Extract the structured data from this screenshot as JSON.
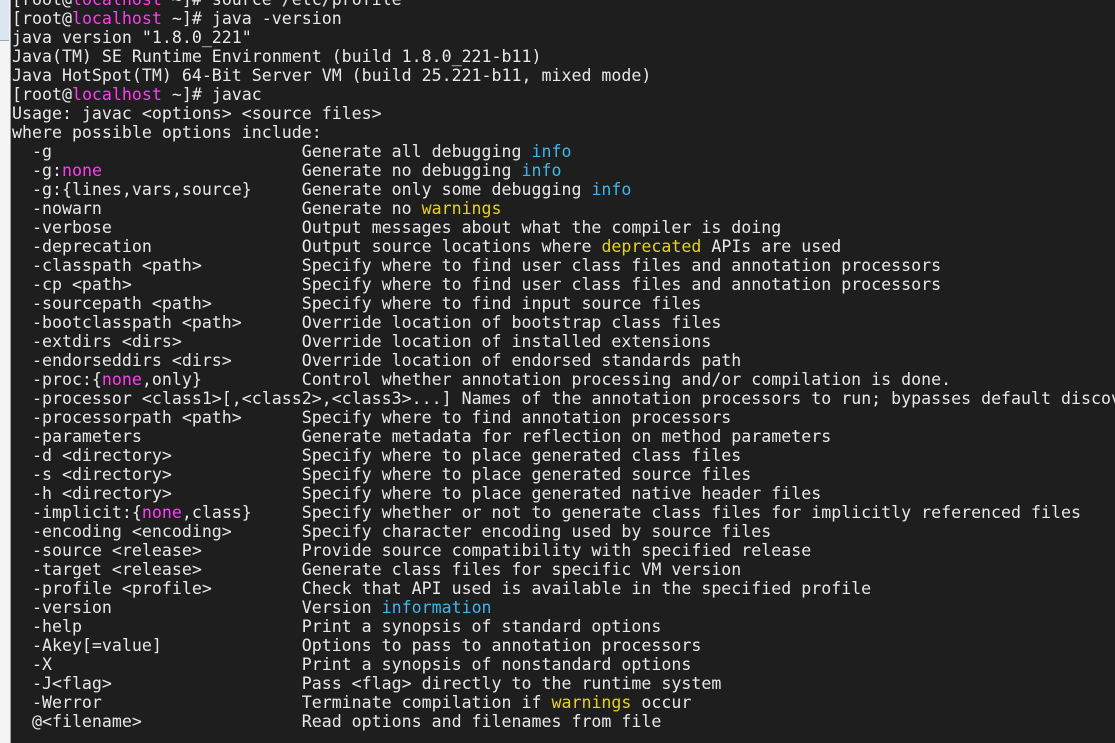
{
  "colors": {
    "background": "#1e1e1e",
    "text": "#e8e8e8",
    "magenta": "#ff3cf0",
    "cyan": "#3fb6e8",
    "yellow": "#e6d21e"
  },
  "header_lines": [
    [
      {
        "t": "[root@"
      },
      {
        "t": "localhost",
        "c": "magenta"
      },
      {
        "t": " ~]# source /etc/profile"
      }
    ],
    [
      {
        "t": "[root@"
      },
      {
        "t": "localhost",
        "c": "magenta"
      },
      {
        "t": " ~]# java -version"
      }
    ],
    [
      {
        "t": "java version \"1.8.0_221\""
      }
    ],
    [
      {
        "t": "Java(TM) SE Runtime Environment (build 1.8.0_221-b11)"
      }
    ],
    [
      {
        "t": "Java HotSpot(TM) 64-Bit Server VM (build 25.221-b11, mixed mode)"
      }
    ],
    [
      {
        "t": "[root@"
      },
      {
        "t": "localhost",
        "c": "magenta"
      },
      {
        "t": " ~]# javac"
      }
    ],
    [
      {
        "t": "Usage: javac <options> <source files>"
      }
    ],
    [
      {
        "t": "where possible options include:"
      }
    ]
  ],
  "options": [
    {
      "opt": [
        {
          "t": "-g"
        }
      ],
      "desc": [
        {
          "t": "Generate all debugging "
        },
        {
          "t": "info",
          "c": "cyan"
        }
      ]
    },
    {
      "opt": [
        {
          "t": "-g:"
        },
        {
          "t": "none",
          "c": "magenta"
        }
      ],
      "desc": [
        {
          "t": "Generate no debugging "
        },
        {
          "t": "info",
          "c": "cyan"
        }
      ]
    },
    {
      "opt": [
        {
          "t": "-g:{lines,vars,source}"
        }
      ],
      "desc": [
        {
          "t": "Generate only some debugging "
        },
        {
          "t": "info",
          "c": "cyan"
        }
      ]
    },
    {
      "opt": [
        {
          "t": "-nowarn"
        }
      ],
      "desc": [
        {
          "t": "Generate no "
        },
        {
          "t": "warnings",
          "c": "yellow"
        }
      ]
    },
    {
      "opt": [
        {
          "t": "-verbose"
        }
      ],
      "desc": [
        {
          "t": "Output messages about what the compiler is doing"
        }
      ]
    },
    {
      "opt": [
        {
          "t": "-deprecation"
        }
      ],
      "desc": [
        {
          "t": "Output source locations where "
        },
        {
          "t": "deprecated",
          "c": "yellow"
        },
        {
          "t": " APIs are used"
        }
      ]
    },
    {
      "opt": [
        {
          "t": "-classpath <path>"
        }
      ],
      "desc": [
        {
          "t": "Specify where to find user class files and annotation processors"
        }
      ]
    },
    {
      "opt": [
        {
          "t": "-cp <path>"
        }
      ],
      "desc": [
        {
          "t": "Specify where to find user class files and annotation processors"
        }
      ]
    },
    {
      "opt": [
        {
          "t": "-sourcepath <path>"
        }
      ],
      "desc": [
        {
          "t": "Specify where to find input source files"
        }
      ]
    },
    {
      "opt": [
        {
          "t": "-bootclasspath <path>"
        }
      ],
      "desc": [
        {
          "t": "Override location of bootstrap class files"
        }
      ]
    },
    {
      "opt": [
        {
          "t": "-extdirs <dirs>"
        }
      ],
      "desc": [
        {
          "t": "Override location of installed extensions"
        }
      ]
    },
    {
      "opt": [
        {
          "t": "-endorseddirs <dirs>"
        }
      ],
      "desc": [
        {
          "t": "Override location of endorsed standards path"
        }
      ]
    },
    {
      "opt": [
        {
          "t": "-proc:{"
        },
        {
          "t": "none",
          "c": "magenta"
        },
        {
          "t": ",only}"
        }
      ],
      "desc": [
        {
          "t": "Control whether annotation processing and/or compilation is done."
        }
      ]
    },
    {
      "opt": [
        {
          "t": "-processor <class1>[,<class2>,<class3>...]"
        }
      ],
      "desc": [
        {
          "t": "Names of the annotation processors to run; bypasses default discov"
        }
      ]
    },
    {
      "opt": [
        {
          "t": "-processorpath <path>"
        }
      ],
      "desc": [
        {
          "t": "Specify where to find annotation processors"
        }
      ]
    },
    {
      "opt": [
        {
          "t": "-parameters"
        }
      ],
      "desc": [
        {
          "t": "Generate metadata for reflection on method parameters"
        }
      ]
    },
    {
      "opt": [
        {
          "t": "-d <directory>"
        }
      ],
      "desc": [
        {
          "t": "Specify where to place generated class files"
        }
      ]
    },
    {
      "opt": [
        {
          "t": "-s <directory>"
        }
      ],
      "desc": [
        {
          "t": "Specify where to place generated source files"
        }
      ]
    },
    {
      "opt": [
        {
          "t": "-h <directory>"
        }
      ],
      "desc": [
        {
          "t": "Specify where to place generated native header files"
        }
      ]
    },
    {
      "opt": [
        {
          "t": "-implicit:{"
        },
        {
          "t": "none",
          "c": "magenta"
        },
        {
          "t": ",class}"
        }
      ],
      "desc": [
        {
          "t": "Specify whether or not to generate class files for implicitly referenced files"
        }
      ]
    },
    {
      "opt": [
        {
          "t": "-encoding <encoding>"
        }
      ],
      "desc": [
        {
          "t": "Specify character encoding used by source files"
        }
      ]
    },
    {
      "opt": [
        {
          "t": "-source <release>"
        }
      ],
      "desc": [
        {
          "t": "Provide source compatibility with specified release"
        }
      ]
    },
    {
      "opt": [
        {
          "t": "-target <release>"
        }
      ],
      "desc": [
        {
          "t": "Generate class files for specific VM version"
        }
      ]
    },
    {
      "opt": [
        {
          "t": "-profile <profile>"
        }
      ],
      "desc": [
        {
          "t": "Check that API used is available in the specified profile"
        }
      ]
    },
    {
      "opt": [
        {
          "t": "-version"
        }
      ],
      "desc": [
        {
          "t": "Version "
        },
        {
          "t": "information",
          "c": "cyan"
        }
      ]
    },
    {
      "opt": [
        {
          "t": "-help"
        }
      ],
      "desc": [
        {
          "t": "Print a synopsis of standard options"
        }
      ]
    },
    {
      "opt": [
        {
          "t": "-Akey[=value]"
        }
      ],
      "desc": [
        {
          "t": "Options to pass to annotation processors"
        }
      ]
    },
    {
      "opt": [
        {
          "t": "-X"
        }
      ],
      "desc": [
        {
          "t": "Print a synopsis of nonstandard options"
        }
      ]
    },
    {
      "opt": [
        {
          "t": "-J<flag>"
        }
      ],
      "desc": [
        {
          "t": "Pass <flag> directly to the runtime system"
        }
      ]
    },
    {
      "opt": [
        {
          "t": "-Werror"
        }
      ],
      "desc": [
        {
          "t": "Terminate compilation if "
        },
        {
          "t": "warnings",
          "c": "yellow"
        },
        {
          "t": " occur"
        }
      ]
    },
    {
      "opt": [
        {
          "t": "@<filename>"
        }
      ],
      "desc": [
        {
          "t": "Read options and filenames from file"
        }
      ]
    }
  ]
}
